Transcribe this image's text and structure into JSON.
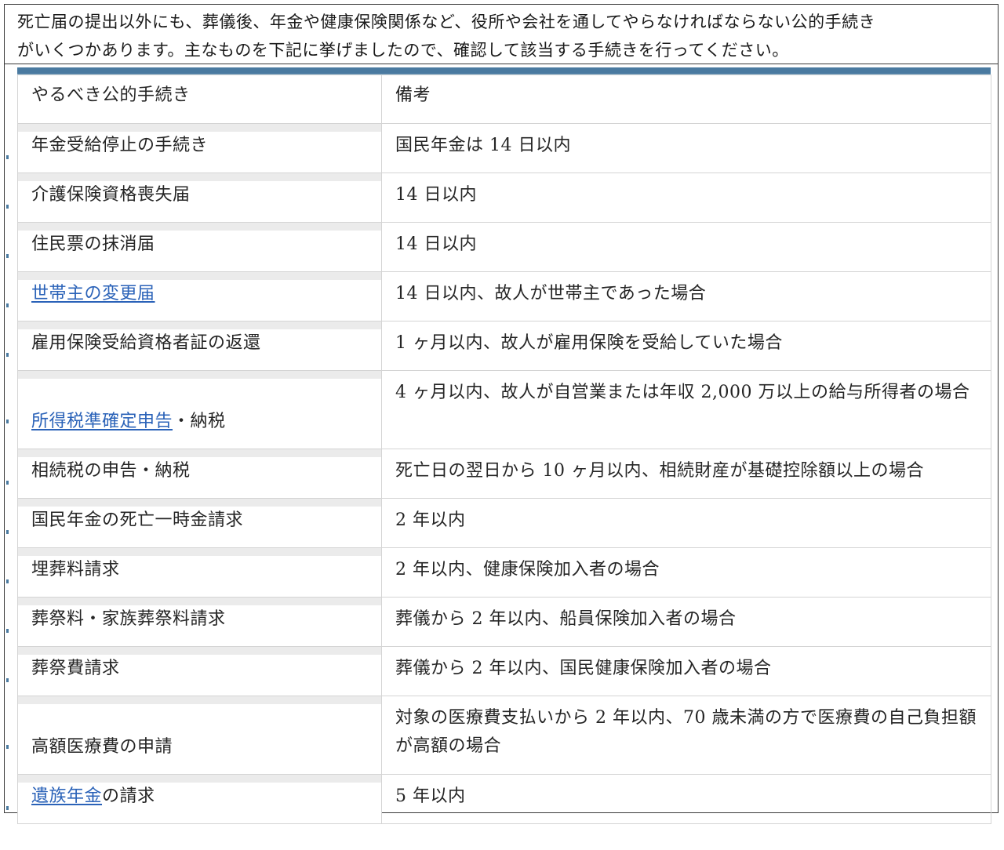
{
  "intro": {
    "line1": "死亡届の提出以外にも、葬儀後、年金や健康保険関係など、役所や会社を通してやらなければならない公的手続き",
    "line2": "がいくつかあります。主なものを下記に挙げましたので、確認して該当する手続きを行ってください。"
  },
  "table": {
    "header": {
      "col1": "やるべき公的手続き",
      "col2": "備考"
    },
    "rows": [
      {
        "name": "年金受給停止の手続き",
        "link": "",
        "suffix": "",
        "note": "国民年金は 14 日以内"
      },
      {
        "name": "介護保険資格喪失届",
        "link": "",
        "suffix": "",
        "note": "14 日以内"
      },
      {
        "name": "住民票の抹消届",
        "link": "",
        "suffix": "",
        "note": "14 日以内"
      },
      {
        "name": "",
        "link": "世帯主の変更届",
        "suffix": "",
        "note": "14 日以内、故人が世帯主であった場合"
      },
      {
        "name": "雇用保険受給資格者証の返還",
        "link": "",
        "suffix": "",
        "note": "1 ヶ月以内、故人が雇用保険を受給していた場合"
      },
      {
        "name": "",
        "link": "所得税準確定申告",
        "suffix": "・納税",
        "note": "4 ヶ月以内、故人が自営業または年収 2,000 万以上の給与所得者の場合"
      },
      {
        "name": "相続税の申告・納税",
        "link": "",
        "suffix": "",
        "note": "死亡日の翌日から 10 ヶ月以内、相続財産が基礎控除額以上の場合"
      },
      {
        "name": "国民年金の死亡一時金請求",
        "link": "",
        "suffix": "",
        "note": "2 年以内"
      },
      {
        "name": "埋葬料請求",
        "link": "",
        "suffix": "",
        "note": "2 年以内、健康保険加入者の場合"
      },
      {
        "name": "葬祭料・家族葬祭料請求",
        "link": "",
        "suffix": "",
        "note": "葬儀から 2 年以内、船員保険加入者の場合"
      },
      {
        "name": "葬祭費請求",
        "link": "",
        "suffix": "",
        "note": "葬儀から 2 年以内、国民健康保険加入者の場合"
      },
      {
        "name": "高額医療費の申請",
        "link": "",
        "suffix": "",
        "note": "対象の医療費支払いから 2 年以内、70 歳未満の方で医療費の自己負担額が高額の場合"
      },
      {
        "name": "",
        "link": "遺族年金",
        "suffix": "の請求",
        "note": "5 年以内"
      }
    ]
  }
}
